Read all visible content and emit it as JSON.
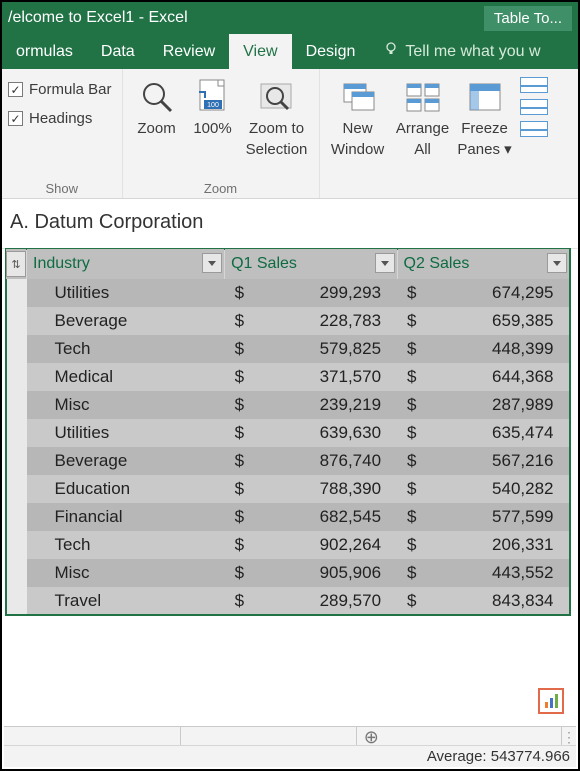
{
  "titlebar": {
    "title": "/elcome to Excel1 - Excel",
    "contextual_tab": "Table To..."
  },
  "tabs": {
    "formulas": "ormulas",
    "data": "Data",
    "review": "Review",
    "view": "View",
    "design": "Design",
    "tellme": "Tell me what you w"
  },
  "ribbon": {
    "show": {
      "formula_bar": "Formula Bar",
      "headings": "Headings",
      "group_label": "Show"
    },
    "zoom": {
      "zoom": "Zoom",
      "hundred": "100%",
      "zoom_to_selection_l1": "Zoom to",
      "zoom_to_selection_l2": "Selection",
      "group_label": "Zoom"
    },
    "window": {
      "new_window_l1": "New",
      "new_window_l2": "Window",
      "arrange_all_l1": "Arrange",
      "arrange_all_l2": "All",
      "freeze_l1": "Freeze",
      "freeze_l2": "Panes ▾"
    }
  },
  "sheet_title": "A. Datum Corporation",
  "columns": {
    "industry": "Industry",
    "q1": "Q1 Sales",
    "q2": "Q2 Sales"
  },
  "rows": [
    {
      "industry": "Utilities",
      "q1": "299,293",
      "q2": "674,295"
    },
    {
      "industry": "Beverage",
      "q1": "228,783",
      "q2": "659,385"
    },
    {
      "industry": "Tech",
      "q1": "579,825",
      "q2": "448,399"
    },
    {
      "industry": "Medical",
      "q1": "371,570",
      "q2": "644,368"
    },
    {
      "industry": "Misc",
      "q1": "239,219",
      "q2": "287,989"
    },
    {
      "industry": "Utilities",
      "q1": "639,630",
      "q2": "635,474"
    },
    {
      "industry": "Beverage",
      "q1": "876,740",
      "q2": "567,216"
    },
    {
      "industry": "Education",
      "q1": "788,390",
      "q2": "540,282"
    },
    {
      "industry": "Financial",
      "q1": "682,545",
      "q2": "577,599"
    },
    {
      "industry": "Tech",
      "q1": "902,264",
      "q2": "206,331"
    },
    {
      "industry": "Misc",
      "q1": "905,906",
      "q2": "443,552"
    },
    {
      "industry": "Travel",
      "q1": "289,570",
      "q2": "843,834"
    }
  ],
  "currency_symbol": "$",
  "status": {
    "average_label": "Average:",
    "average_value": "543774.966"
  }
}
